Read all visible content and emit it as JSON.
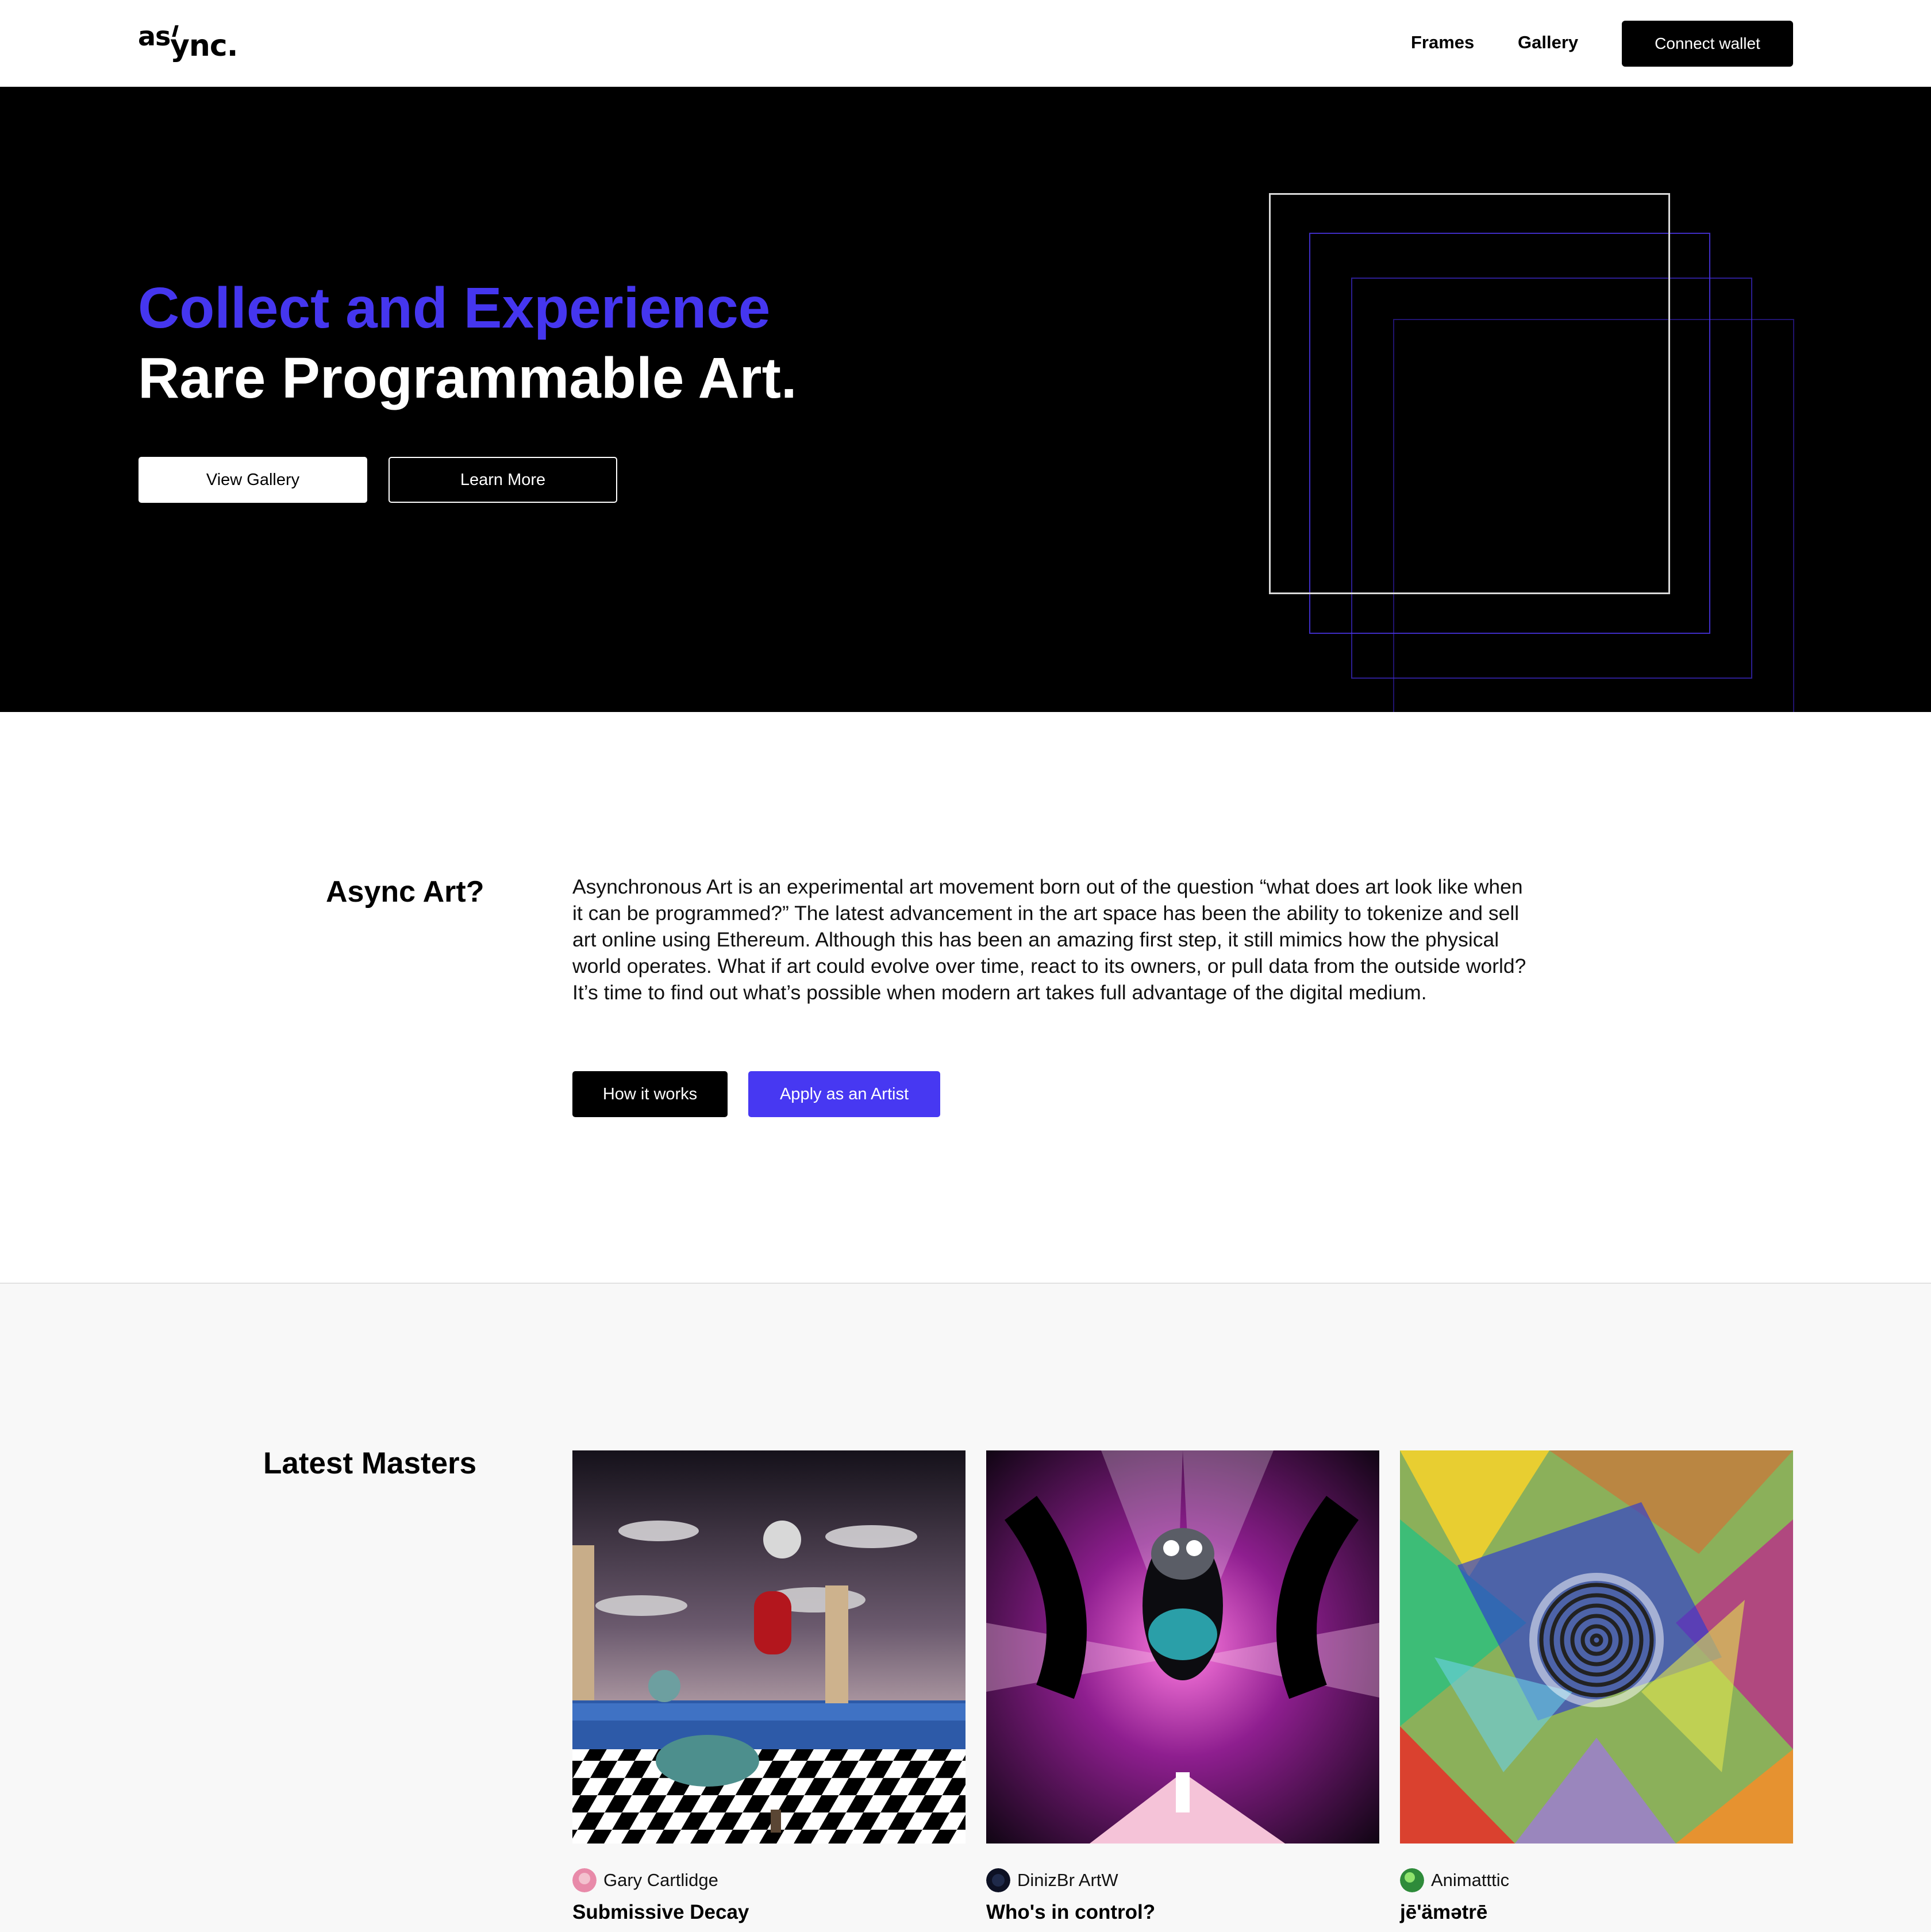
{
  "header": {
    "logo": {
      "part1": "as",
      "part2": "ync."
    },
    "nav": {
      "frames": "Frames",
      "gallery": "Gallery"
    },
    "connect_wallet": "Connect wallet"
  },
  "hero": {
    "title_line1": "Collect and Experience",
    "title_line2": "Rare Programmable Art.",
    "view_gallery": "View Gallery",
    "learn_more": "Learn More"
  },
  "about": {
    "title": "Async Art?",
    "body": "Asynchronous Art is an experimental art movement born out of the question “what does art look like when it can be programmed?” The latest advancement in the art space has been the ability to tokenize and sell art online using Ethereum. Although this has been an amazing first step, it still mimics how the physical world operates. What if art could evolve over time, react to its owners, or pull data from the outside world? It’s time to find out what’s possible when modern art takes full advantage of the digital medium.",
    "how_it_works": "How it works",
    "apply_artist": "Apply as an Artist"
  },
  "masters": {
    "title": "Latest Masters",
    "cards": [
      {
        "artist": "Gary Cartlidge",
        "title": "Submissive Decay"
      },
      {
        "artist": "DinizBr ArtW",
        "title": "Who's in control?"
      },
      {
        "artist": "Animatttic",
        "title": "jē'ämətrē"
      }
    ]
  },
  "colors": {
    "accent": "#4536ef",
    "hero_bg": "#000000",
    "section_bg": "#f8f8f8"
  }
}
